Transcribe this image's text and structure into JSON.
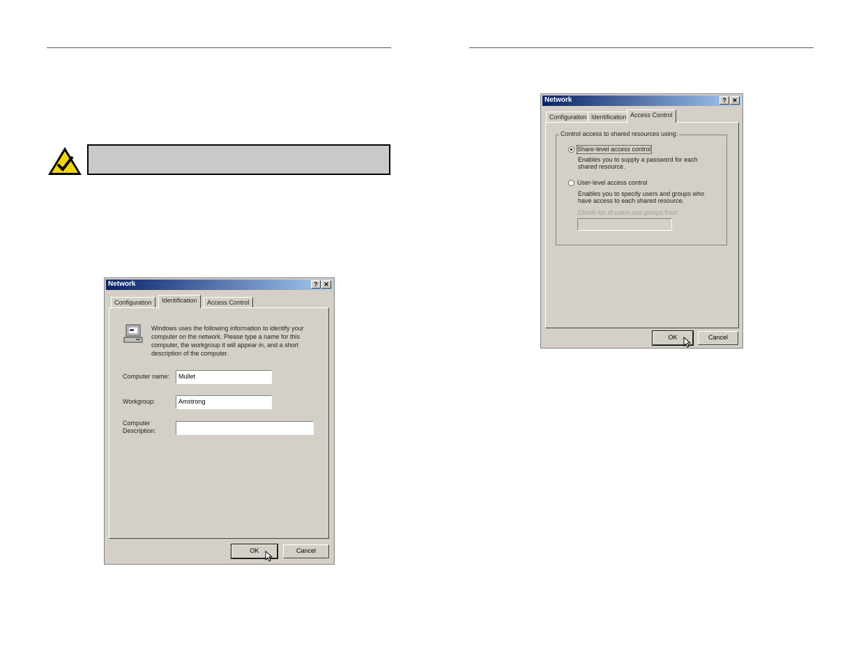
{
  "colors": {
    "note_bg": "#c9c9c9",
    "dialog_bg": "#d4d0c8",
    "titlebar_start": "#0a246a",
    "titlebar_end": "#a6caf0",
    "check_icon": "#f2d600"
  },
  "icons": {
    "note": "checkmark-triangle-icon",
    "computer": "computer-icon",
    "cursor": "mouse-pointer-icon"
  },
  "dialog1": {
    "title": "Network",
    "help_btn": "?",
    "close_btn": "✕",
    "tabs": [
      "Configuration",
      "Identification",
      "Access Control"
    ],
    "active_tab": "Identification",
    "intro": "Windows uses the following information to identify your computer on the network.  Please type a name for this computer, the workgroup it will appear in, and a short description of the computer.",
    "computer_name_label": "Computer name:",
    "computer_name_value": "Mullet",
    "workgroup_label": "Workgroup:",
    "workgroup_value": "Amstrong",
    "description_label_1": "Computer",
    "description_label_2": "Description:",
    "description_value": "",
    "ok": "OK",
    "cancel": "Cancel"
  },
  "dialog2": {
    "title": "Network",
    "help_btn": "?",
    "close_btn": "✕",
    "tabs": [
      "Configuration",
      "Identification",
      "Access Control"
    ],
    "active_tab": "Access Control",
    "group_title": "Control access to shared resources using:",
    "share_level_label": "Share-level access control",
    "share_level_desc": "Enables you to supply a password for each shared resource.",
    "share_level_selected": true,
    "user_level_label": "User-level access control",
    "user_level_desc": "Enables you to specify users and groups who have access to each shared resource.",
    "obtain_list_label": "Obtain list of users and groups from:",
    "obtain_list_value": "",
    "ok": "OK",
    "cancel": "Cancel"
  }
}
